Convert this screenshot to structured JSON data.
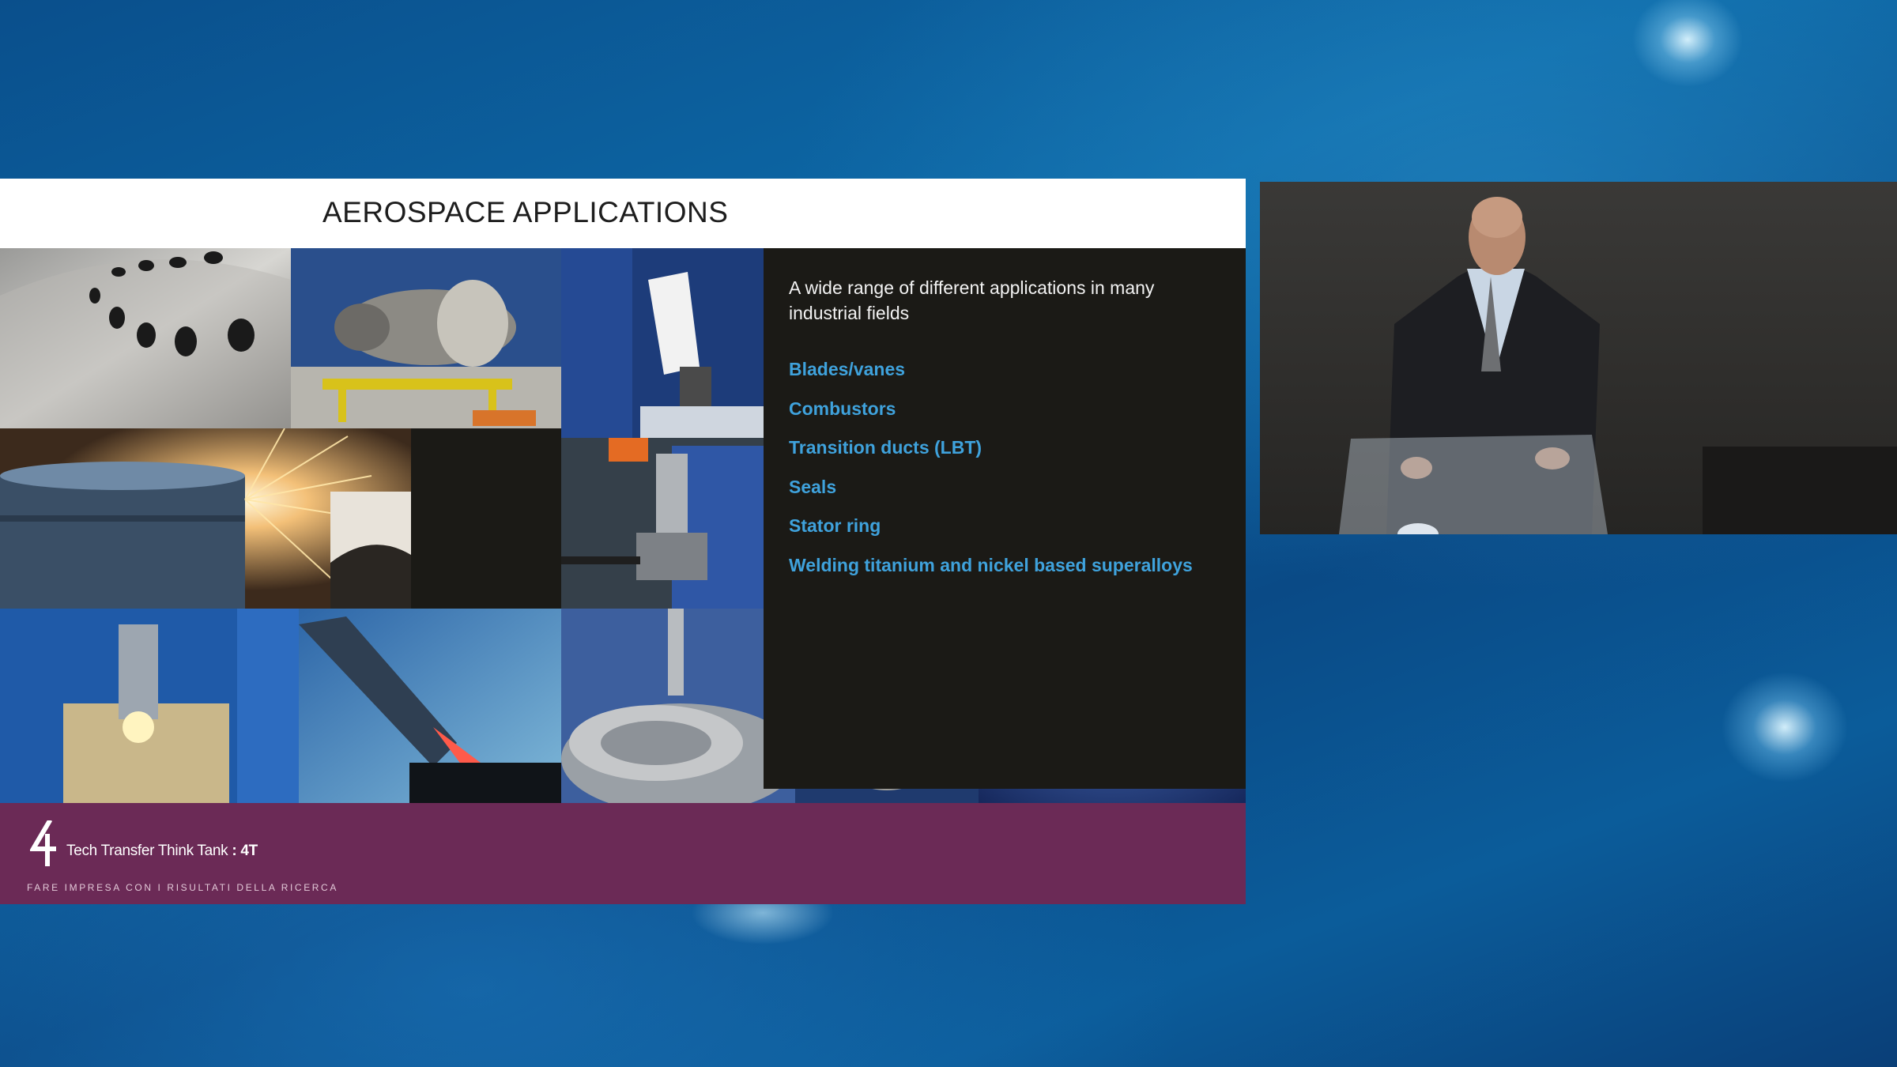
{
  "slide": {
    "title": "AEROSPACE APPLICATIONS",
    "intro": "A wide range of different applications in many industrial fields",
    "applications": [
      "Blades/vanes",
      "Combustors",
      "Transition ducts (LBT)",
      "Seals",
      "Stator ring",
      "Welding titanium and nickel based superalloys"
    ],
    "footer": {
      "logo_text": "Tech Transfer Think Tank",
      "logo_suffix": "4T",
      "tagline": "FARE IMPRESA CON I RISULTATI DELLA RICERCA"
    }
  },
  "colors": {
    "list_text": "#3fa2dc",
    "footer_bg": "#6b2a56",
    "slide_bg": "#1b1a16"
  }
}
